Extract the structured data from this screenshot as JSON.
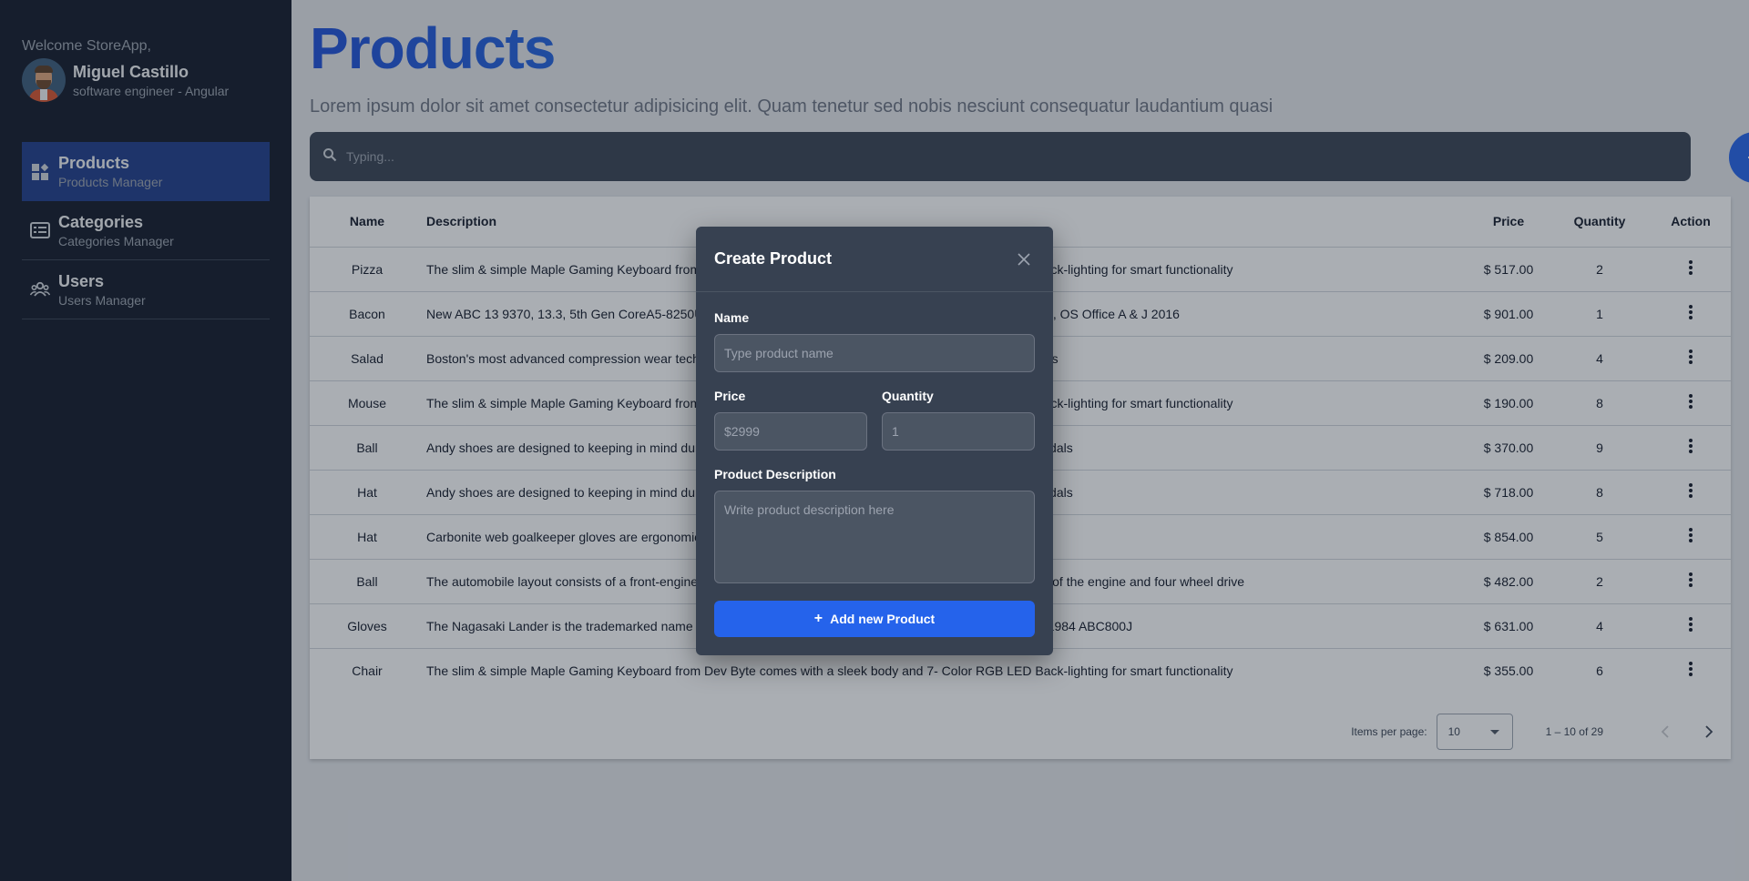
{
  "user": {
    "welcome": "Welcome StoreApp,",
    "name": "Miguel Castillo",
    "role": "software engineer - Angular"
  },
  "sidebar": {
    "items": [
      {
        "title": "Products",
        "subtitle": "Products Manager",
        "icon": "dashboard-icon",
        "active": true
      },
      {
        "title": "Categories",
        "subtitle": "Categories Manager",
        "icon": "list-card-icon",
        "active": false
      },
      {
        "title": "Users",
        "subtitle": "Users Manager",
        "icon": "people-icon",
        "active": false
      }
    ]
  },
  "page": {
    "title": "Products",
    "description": "Lorem ipsum dolor sit amet consectetur adipisicing elit. Quam tenetur sed nobis nesciunt consequatur laudantium quasi"
  },
  "search": {
    "placeholder": "Typing..."
  },
  "table": {
    "headers": {
      "name": "Name",
      "description": "Description",
      "price": "Price",
      "quantity": "Quantity",
      "action": "Action"
    },
    "rows": [
      {
        "name": "Pizza",
        "description": "The slim & simple Maple Gaming Keyboard from Dev Byte comes with a sleek body and 7- Color RGB LED Back-lighting for smart functionality",
        "price": "$ 517.00",
        "quantity": "2"
      },
      {
        "name": "Bacon",
        "description": "New ABC 13 9370, 13.3, 5th Gen CoreA5-8250U, 8GB RAM, 256GB SSD, power UHD Graphics, OS 10 Home, OS Office A & J 2016",
        "price": "$ 901.00",
        "quantity": "1"
      },
      {
        "name": "Salad",
        "description": "Boston's most advanced compression wear technology increases muscle oxygenation, stabilizes active muscles",
        "price": "$ 209.00",
        "quantity": "4"
      },
      {
        "name": "Mouse",
        "description": "The slim & simple Maple Gaming Keyboard from Dev Byte comes with a sleek body and 7- Color RGB LED Back-lighting for smart functionality",
        "price": "$ 190.00",
        "quantity": "8"
      },
      {
        "name": "Ball",
        "description": "Andy shoes are designed to keeping in mind durability as well as trends, the most stylish range of shoes & sandals",
        "price": "$ 370.00",
        "quantity": "9"
      },
      {
        "name": "Hat",
        "description": "Andy shoes are designed to keeping in mind durability as well as trends, the most stylish range of shoes & sandals",
        "price": "$ 718.00",
        "quantity": "8"
      },
      {
        "name": "Hat",
        "description": "Carbonite web goalkeeper gloves are ergonomically designed to give easy fit",
        "price": "$ 854.00",
        "quantity": "5"
      },
      {
        "name": "Ball",
        "description": "The automobile layout consists of a front-engine design, with transaxle-type transmissions mounted at the rear of the engine and four wheel drive",
        "price": "$ 482.00",
        "quantity": "2"
      },
      {
        "name": "Gloves",
        "description": "The Nagasaki Lander is the trademarked name of several series of Nagasaki sport bikes, that started with the 1984 ABC800J",
        "price": "$ 631.00",
        "quantity": "4"
      },
      {
        "name": "Chair",
        "description": "The slim & simple Maple Gaming Keyboard from Dev Byte comes with a sleek body and 7- Color RGB LED Back-lighting for smart functionality",
        "price": "$ 355.00",
        "quantity": "6"
      }
    ]
  },
  "paginator": {
    "items_per_page_label": "Items per page:",
    "items_per_page_value": "10",
    "range": "1 – 10 of 29"
  },
  "modal": {
    "title": "Create Product",
    "name_label": "Name",
    "name_placeholder": "Type product name",
    "price_label": "Price",
    "price_placeholder": "$2999",
    "quantity_label": "Quantity",
    "quantity_placeholder": "1",
    "description_label": "Product Description",
    "description_placeholder": "Write product description here",
    "submit_label": "Add new Product"
  },
  "colors": {
    "sidebar_bg": "#111827",
    "active_nav": "#1e3a8a",
    "accent": "#2563eb",
    "modal_bg": "#374151"
  }
}
